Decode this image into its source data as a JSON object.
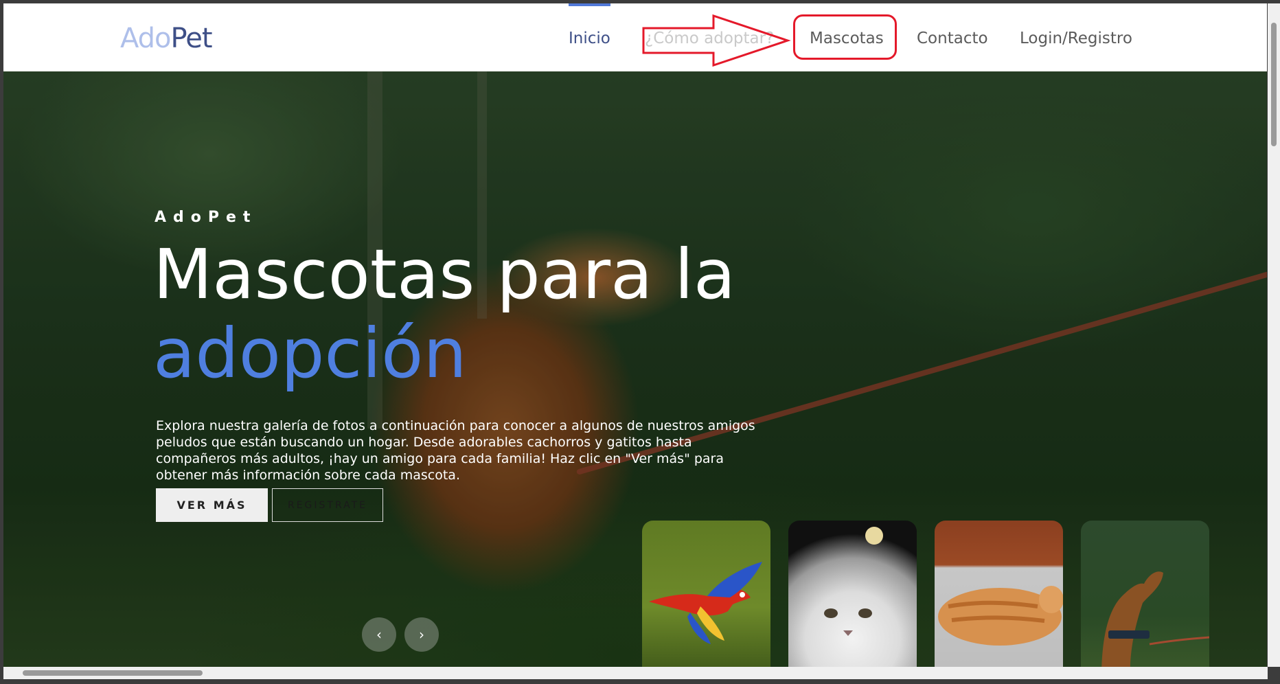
{
  "nav": {
    "logo_part1": "Ado",
    "logo_part2": "Pet",
    "items": [
      {
        "label": "Inicio"
      },
      {
        "label": "¿Cómo adoptar?"
      },
      {
        "label": "Mascotas"
      },
      {
        "label": "Contacto"
      },
      {
        "label": "Login/Registro"
      }
    ]
  },
  "hero": {
    "eyebrow": "AdoPet",
    "headline": "Mascotas para la",
    "headline_accent": "adopción",
    "description": "Explora nuestra galería de fotos a continuación para conocer a algunos de nuestros amigos peludos que están buscando un hogar. Desde adorables cachorros y gatitos hasta compañeros más adultos, ¡hay un amigo para cada familia! Haz clic en \"Ver más\" para obtener más información sobre cada mascota.",
    "primary_button": "VER MÁS",
    "secondary_button": "REGISTRATE",
    "prev_button": "‹",
    "next_button": "›"
  },
  "colors": {
    "accent": "#4f7fe0",
    "annotation": "#e4192a"
  },
  "thumbnails": [
    {
      "icon": "parrot-photo"
    },
    {
      "icon": "white-persian-cat-photo"
    },
    {
      "icon": "orange-tabby-cat-photo"
    },
    {
      "icon": "spaniel-dog-photo"
    }
  ]
}
